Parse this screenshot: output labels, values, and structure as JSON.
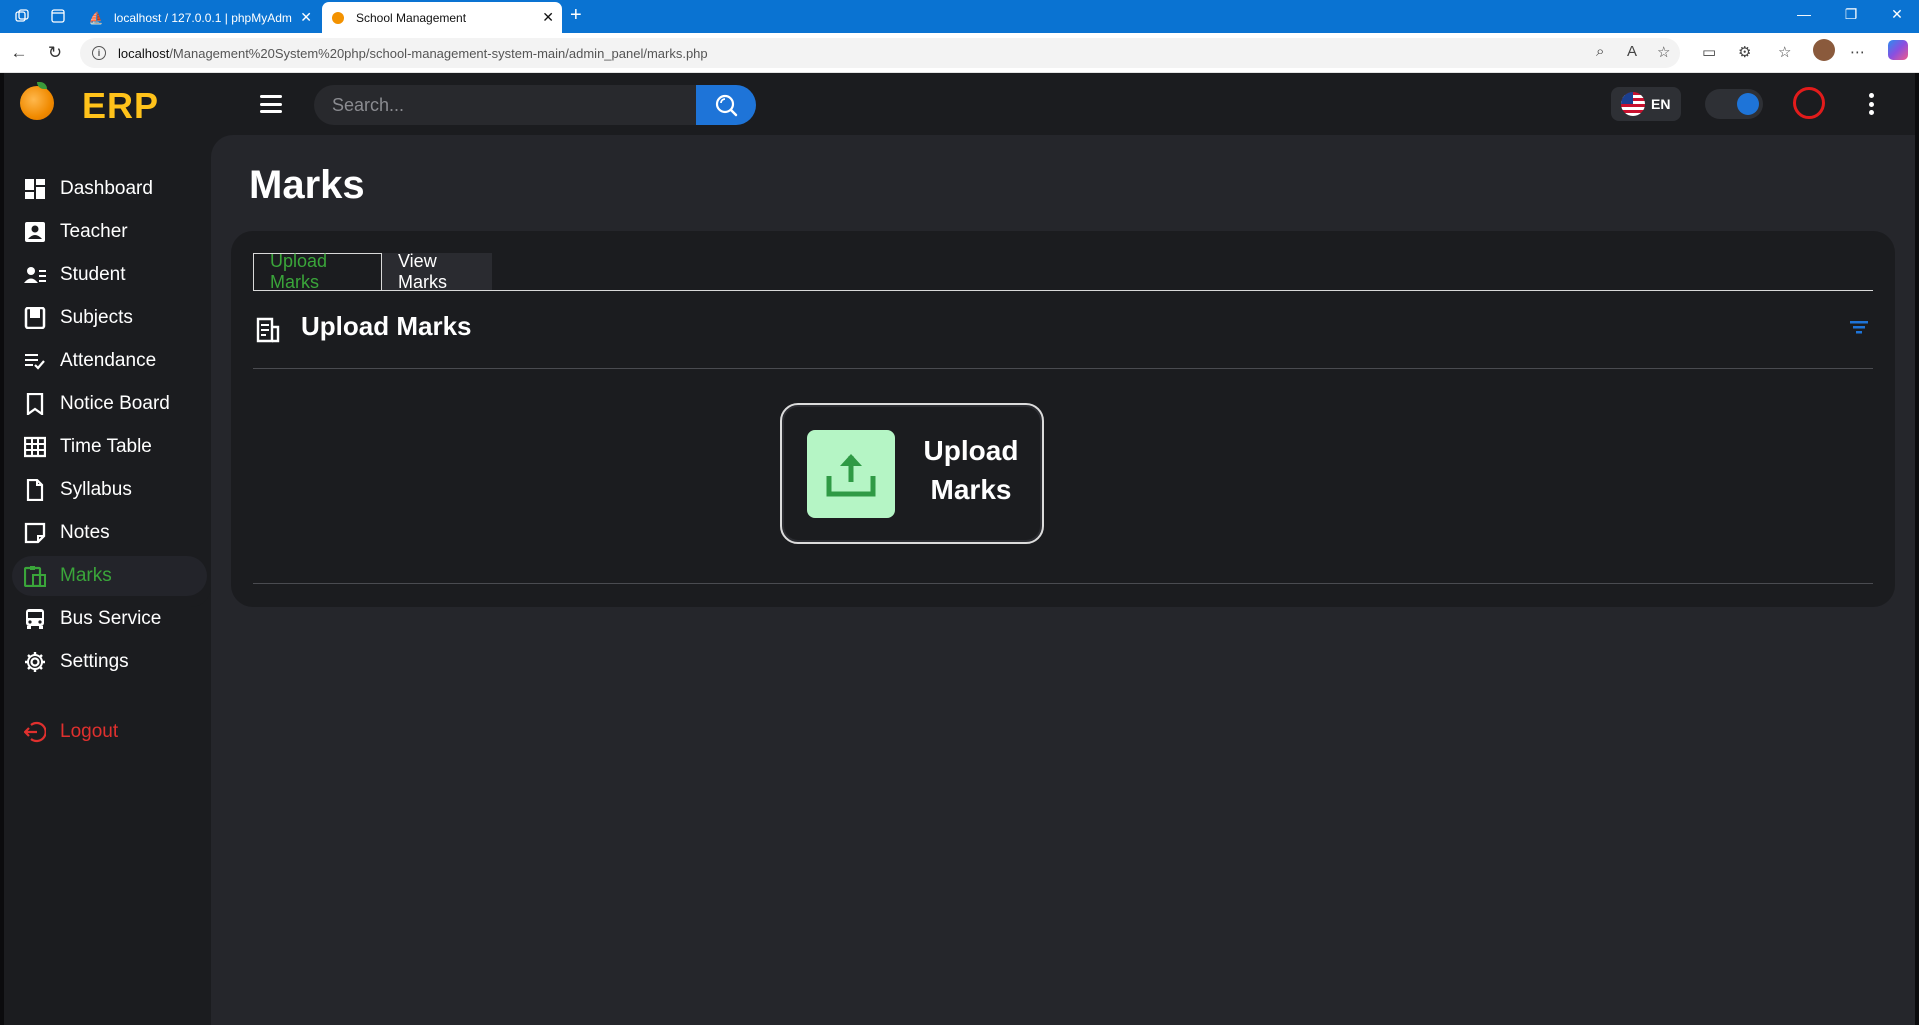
{
  "browser": {
    "tabs": [
      {
        "title": "localhost / 127.0.0.1 | phpMyAdm"
      },
      {
        "title": "School Management"
      }
    ],
    "url_host": "localhost",
    "url_path": "/Management%20System%20php/school-management-system-main/admin_panel/marks.php"
  },
  "app": {
    "logo_text": "ERP",
    "search_placeholder": "Search...",
    "language": "EN",
    "colors": {
      "accent": "#1e74d8",
      "active_green": "#3aa53a",
      "logout_red": "#e0302e",
      "brand_yellow": "#ffc21a"
    }
  },
  "sidebar": {
    "items": [
      {
        "label": "Dashboard",
        "icon": "dashboard-icon"
      },
      {
        "label": "Teacher",
        "icon": "teacher-icon"
      },
      {
        "label": "Student",
        "icon": "student-icon"
      },
      {
        "label": "Subjects",
        "icon": "subjects-icon"
      },
      {
        "label": "Attendance",
        "icon": "attendance-icon"
      },
      {
        "label": "Notice Board",
        "icon": "bookmark-icon"
      },
      {
        "label": "Time Table",
        "icon": "table-icon"
      },
      {
        "label": "Syllabus",
        "icon": "file-icon"
      },
      {
        "label": "Notes",
        "icon": "note-icon"
      },
      {
        "label": "Marks",
        "icon": "marks-icon",
        "active": true
      },
      {
        "label": "Bus Service",
        "icon": "bus-icon"
      },
      {
        "label": "Settings",
        "icon": "gear-icon"
      }
    ],
    "logout": "Logout"
  },
  "main": {
    "page_title": "Marks",
    "tabs": [
      {
        "label": "Upload Marks",
        "active": true
      },
      {
        "label": "View Marks"
      }
    ],
    "section_title": "Upload Marks",
    "upload_button_label": "Upload Marks"
  }
}
